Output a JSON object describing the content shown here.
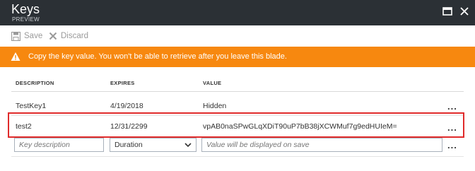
{
  "header": {
    "title": "Keys",
    "subtitle": "PREVIEW",
    "color": "#2b3035"
  },
  "toolbar": {
    "save_label": "Save",
    "discard_label": "Discard"
  },
  "warning": {
    "text": "Copy the key value. You won't be able to retrieve after you leave this blade.",
    "color": "#f7880f"
  },
  "table": {
    "columns": [
      "DESCRIPTION",
      "EXPIRES",
      "VALUE"
    ],
    "rows": [
      {
        "description": "TestKey1",
        "expires": "4/19/2018",
        "value": "Hidden",
        "more": "..."
      },
      {
        "description": "test2",
        "expires": "12/31/2299",
        "value": "vpAB0naSPwGLqXDiT90uP7bB38jXCWMuf7g9edHUIeM=",
        "more": "...",
        "highlighted": true
      }
    ],
    "highlight_color": "#e02b2b"
  },
  "new_row": {
    "description_placeholder": "Key description",
    "duration_selected": "Duration",
    "value_placeholder": "Value will be displayed on save",
    "more": "..."
  }
}
